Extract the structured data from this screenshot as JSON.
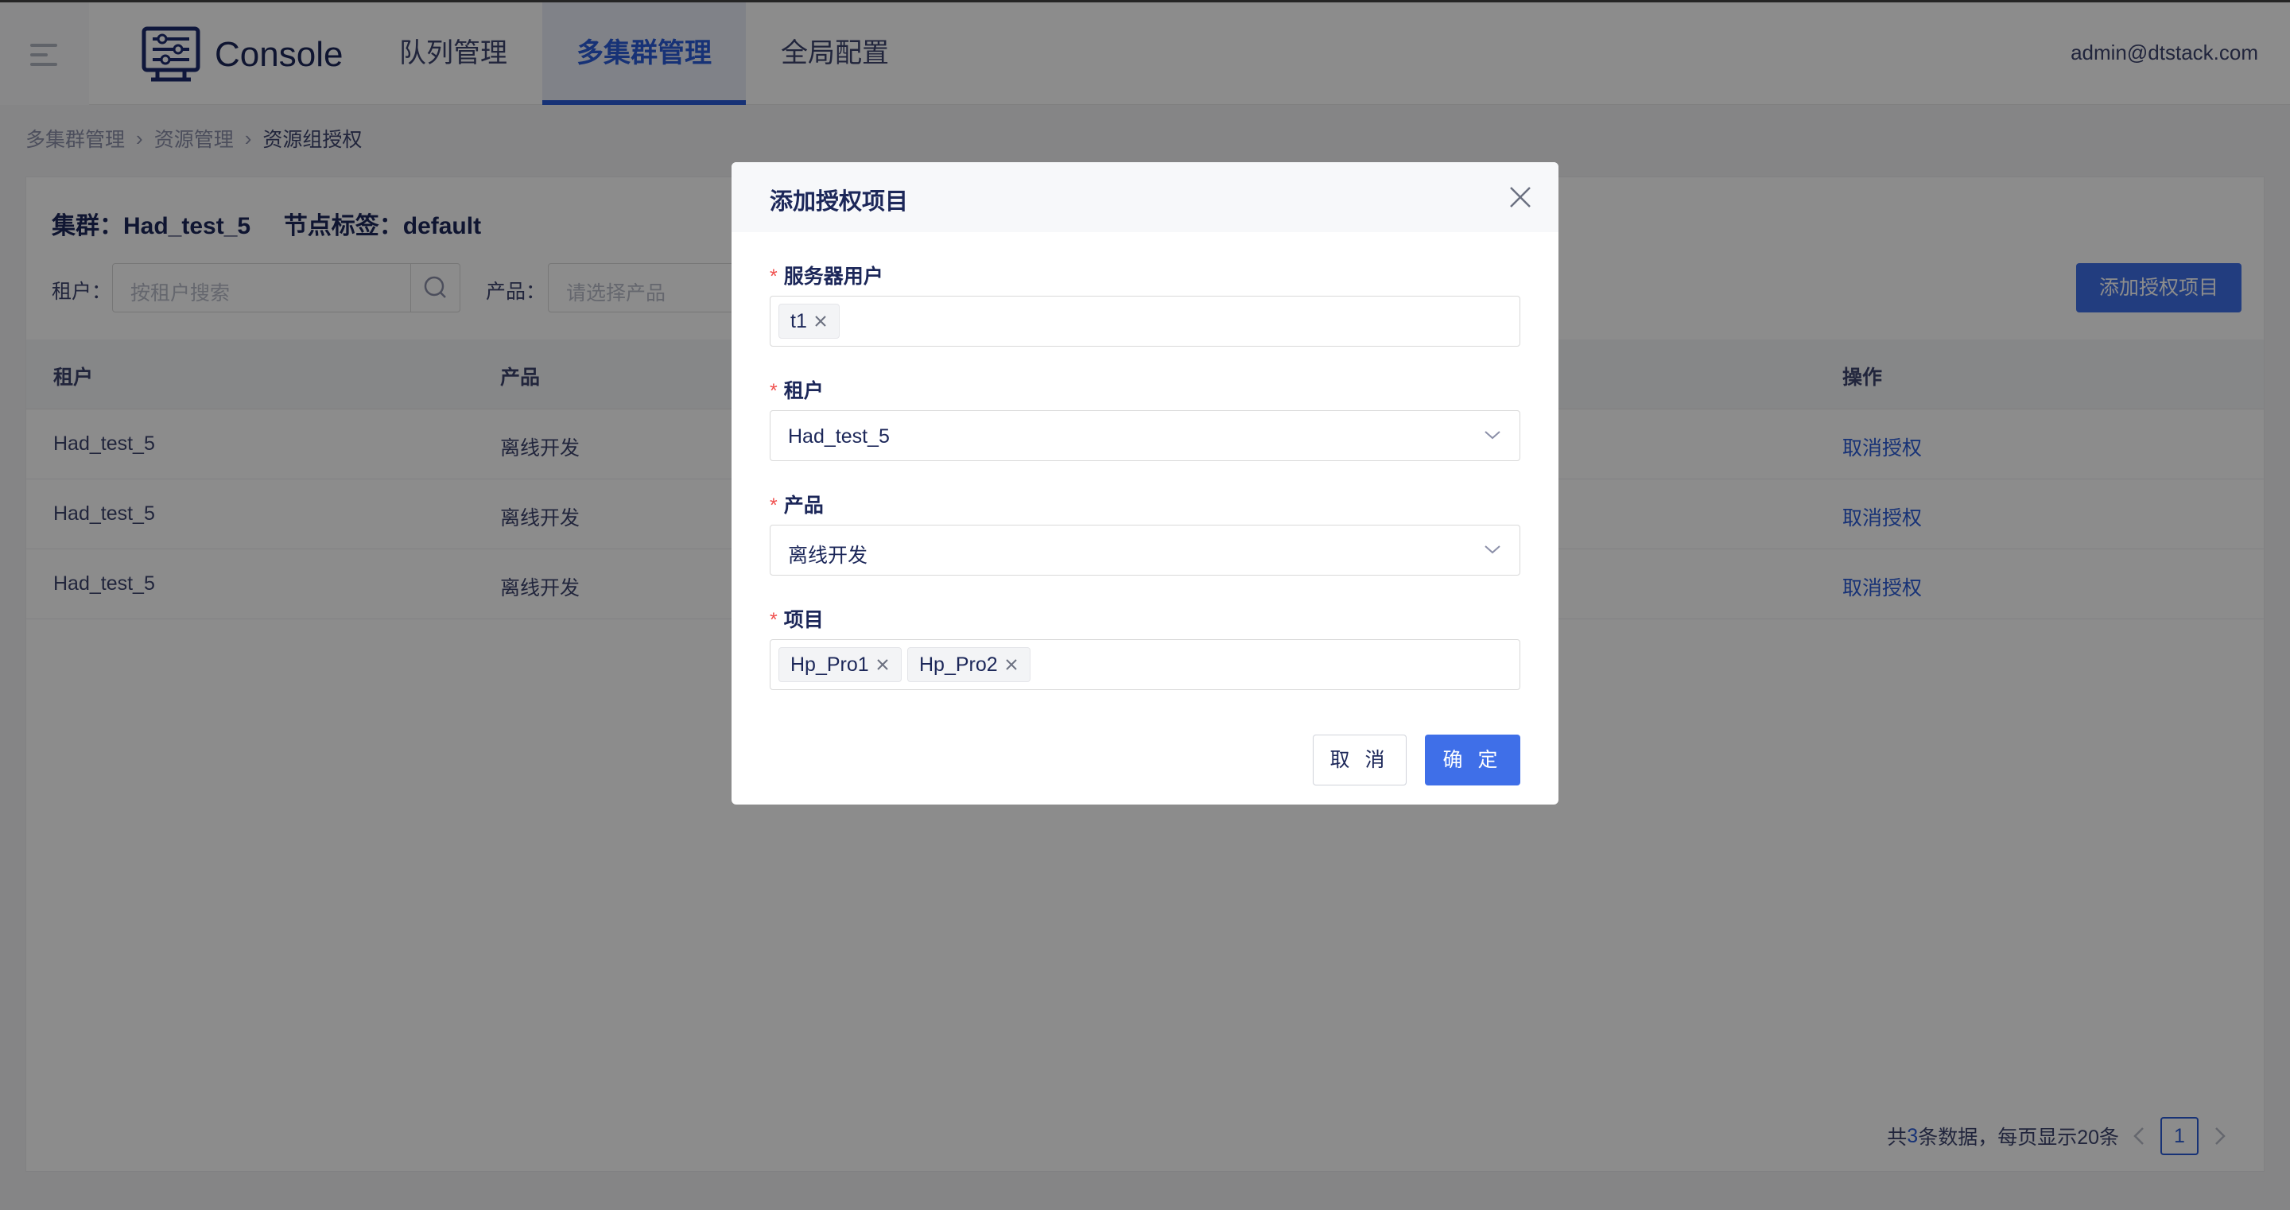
{
  "header": {
    "app_title": "Console",
    "tabs": [
      {
        "label": "队列管理",
        "active": false
      },
      {
        "label": "多集群管理",
        "active": true
      },
      {
        "label": "全局配置",
        "active": false
      }
    ],
    "user": "admin@dtstack.com"
  },
  "breadcrumb": [
    "多集群管理",
    "资源管理",
    "资源组授权"
  ],
  "page": {
    "cluster_title": "集群：Had_test_5     节点标签：default",
    "filters": {
      "tenant_label": "租户：",
      "tenant_placeholder": "按租户搜索",
      "product_label": "产品：",
      "product_placeholder": "请选择产品"
    },
    "add_button": "添加授权项目",
    "table": {
      "columns": [
        "租户",
        "产品",
        "操作"
      ],
      "rows": [
        {
          "tenant": "Had_test_5",
          "product": "离线开发",
          "action": "取消授权"
        },
        {
          "tenant": "Had_test_5",
          "product": "离线开发",
          "action": "取消授权"
        },
        {
          "tenant": "Had_test_5",
          "product": "离线开发",
          "action": "取消授权"
        }
      ]
    },
    "pagination": {
      "prefix": "共",
      "total": "3",
      "suffix": "条数据，每页显示20条",
      "current_page": "1"
    }
  },
  "modal": {
    "title": "添加授权项目",
    "fields": {
      "server_user": {
        "label": "服务器用户",
        "tags": [
          "t1"
        ]
      },
      "tenant": {
        "label": "租户",
        "value": "Had_test_5"
      },
      "product": {
        "label": "产品",
        "value": "离线开发"
      },
      "project": {
        "label": "项目",
        "tags": [
          "Hp_Pro1",
          "Hp_Pro2"
        ]
      }
    },
    "cancel": "取 消",
    "ok": "确 定"
  },
  "colors": {
    "primary": "#3f6fe8",
    "link": "#2a5cd8",
    "required": "#f0514f"
  }
}
